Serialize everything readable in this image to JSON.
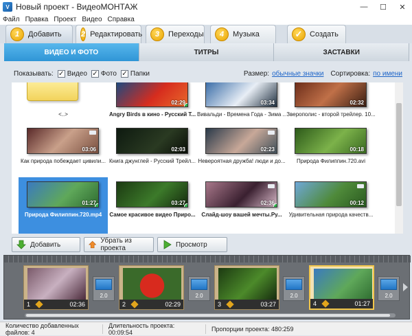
{
  "window": {
    "title": "Новый проект - ВидеоМОНТАЖ",
    "icon_label": "V",
    "minimize": "—",
    "maximize": "☐",
    "close": "✕"
  },
  "menu": [
    "Файл",
    "Правка",
    "Проект",
    "Видео",
    "Справка"
  ],
  "steps": [
    {
      "num": "1",
      "label": "Добавить"
    },
    {
      "num": "2",
      "label": "Редактировать"
    },
    {
      "num": "3",
      "label": "Переходы"
    },
    {
      "num": "4",
      "label": "Музыка"
    },
    {
      "num": "✓",
      "label": "Создать"
    }
  ],
  "subtabs": [
    "ВИДЕО И ФОТО",
    "ТИТРЫ",
    "ЗАСТАВКИ"
  ],
  "filter": {
    "show_label": "Показывать:",
    "video": "Видео",
    "photo": "Фото",
    "folders": "Папки",
    "size_label": "Размер:",
    "size_value": "обычные значки",
    "sort_label": "Сортировка:",
    "sort_value": "по имени"
  },
  "media": [
    {
      "caption": "<..>",
      "duration": ""
    },
    {
      "caption": "Angry Birds в кино - Русский Т...",
      "duration": "02:29"
    },
    {
      "caption": "Вивальди - Времена Года - Зима ...",
      "duration": "03:34"
    },
    {
      "caption": "Зверополис - второй трейлер. 10...",
      "duration": "02:32"
    },
    {
      "caption": "Как природа побеждает цивили...",
      "duration": "03:06"
    },
    {
      "caption": "Книга джунглей - Русский Трейл...",
      "duration": "02:03"
    },
    {
      "caption": "Невероятная дружба! люди и до...",
      "duration": "02:23"
    },
    {
      "caption": "Природа Филиппин.720.avi",
      "duration": "00:18"
    },
    {
      "caption": "Природа Филиппин.720.mp4",
      "duration": "01:27"
    },
    {
      "caption": "Самое красивое видео Приро...",
      "duration": "03:27"
    },
    {
      "caption": "Слайд-шоу вашей мечты.Ру...",
      "duration": "02:36"
    },
    {
      "caption": "Удивительная природа качеств...",
      "duration": "00:12"
    }
  ],
  "actions": {
    "add": "Добавить",
    "remove": "Убрать из проекта",
    "preview": "Просмотр"
  },
  "timeline": {
    "clips": [
      {
        "num": "1",
        "duration": "02:36"
      },
      {
        "num": "2",
        "duration": "02:29"
      },
      {
        "num": "3",
        "duration": "03:27"
      },
      {
        "num": "4",
        "duration": "01:27"
      }
    ],
    "transitions": [
      "2.0",
      "2.0",
      "2.0",
      "2.0"
    ]
  },
  "status": {
    "files": "Количество добавленных файлов: 4",
    "duration": "Длительность проекта: 00:09:54",
    "ratio": "Пропорции проекта: 480:259"
  },
  "colors": {
    "accent": "#3d8fe0",
    "step_badge": "#f0b400",
    "active_tab": "#2f95d6"
  }
}
